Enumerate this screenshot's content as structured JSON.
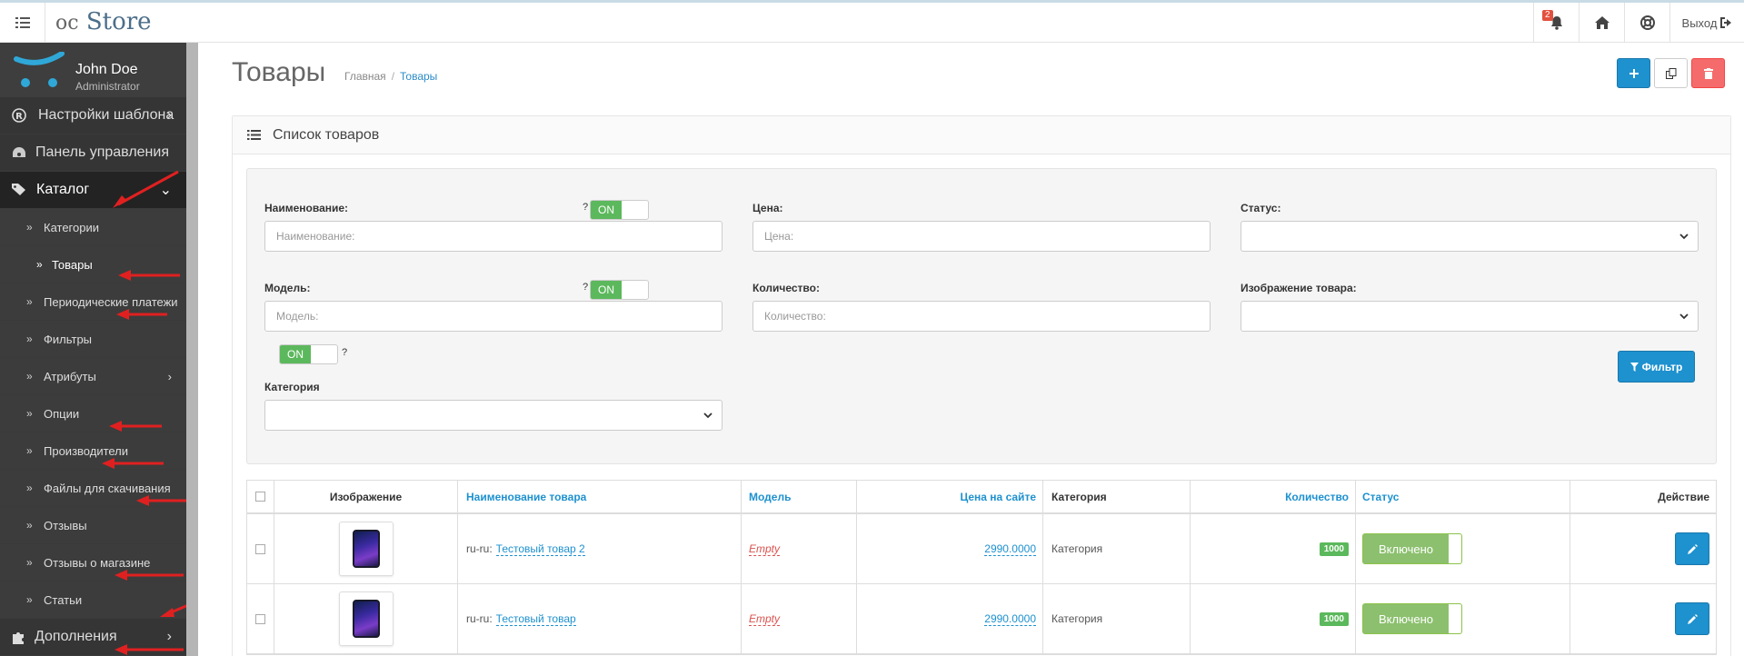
{
  "header": {
    "logo_prefix": "oc",
    "logo_main": "Store",
    "notifications_count": "2",
    "logout_label": "Выход"
  },
  "profile": {
    "name": "John Doe",
    "role": "Administrator"
  },
  "sidebar": {
    "items": [
      {
        "label": "Настройки шаблона",
        "icon": "registered-icon",
        "has_children": true
      },
      {
        "label": "Панель управления",
        "icon": "dashboard-icon",
        "has_children": false
      },
      {
        "label": "Каталог",
        "icon": "tags-icon",
        "has_children": true,
        "expanded": true
      },
      {
        "label": "Дополнения",
        "icon": "puzzle-icon",
        "has_children": true
      }
    ],
    "catalog_children": [
      {
        "label": "Категории"
      },
      {
        "label": "Товары",
        "current": true
      },
      {
        "label": "Периодические платежи"
      },
      {
        "label": "Фильтры"
      },
      {
        "label": "Атрибуты",
        "has_children": true
      },
      {
        "label": "Опции"
      },
      {
        "label": "Производители"
      },
      {
        "label": "Файлы для скачивания"
      },
      {
        "label": "Отзывы"
      },
      {
        "label": "Отзывы о магазине"
      },
      {
        "label": "Статьи"
      }
    ]
  },
  "page": {
    "title": "Товары",
    "breadcrumb": [
      "Главная",
      "Товары"
    ],
    "panel_title": "Список товаров"
  },
  "filter": {
    "name_label": "Наименование:",
    "name_placeholder": "Наименование:",
    "price_label": "Цена:",
    "price_placeholder": "Цена:",
    "status_label": "Статус:",
    "model_label": "Модель:",
    "model_placeholder": "Модель:",
    "quantity_label": "Количество:",
    "quantity_placeholder": "Количество:",
    "image_label": "Изображение товара:",
    "category_label": "Категория",
    "toggle_on": "ON",
    "help_mark": "?",
    "filter_button": "Фильтр"
  },
  "table": {
    "columns": [
      "Изображение",
      "Наименование товара",
      "Модель",
      "Цена на сайте",
      "Категория",
      "Количество",
      "Статус",
      "Действие"
    ],
    "rows": [
      {
        "lang": "ru-ru:",
        "name": "Тестовый товар 2",
        "model": "Empty",
        "price": "2990.0000",
        "category": "Категория",
        "quantity": "1000",
        "status": "Включено"
      },
      {
        "lang": "ru-ru:",
        "name": "Тестовый товар",
        "model": "Empty",
        "price": "2990.0000",
        "category": "Категория",
        "quantity": "1000",
        "status": "Включено"
      }
    ]
  },
  "colors": {
    "primary": "#1e91cf",
    "success": "#5cb85c",
    "danger": "#f56b6b",
    "annotation_arrow": "#e02020"
  }
}
